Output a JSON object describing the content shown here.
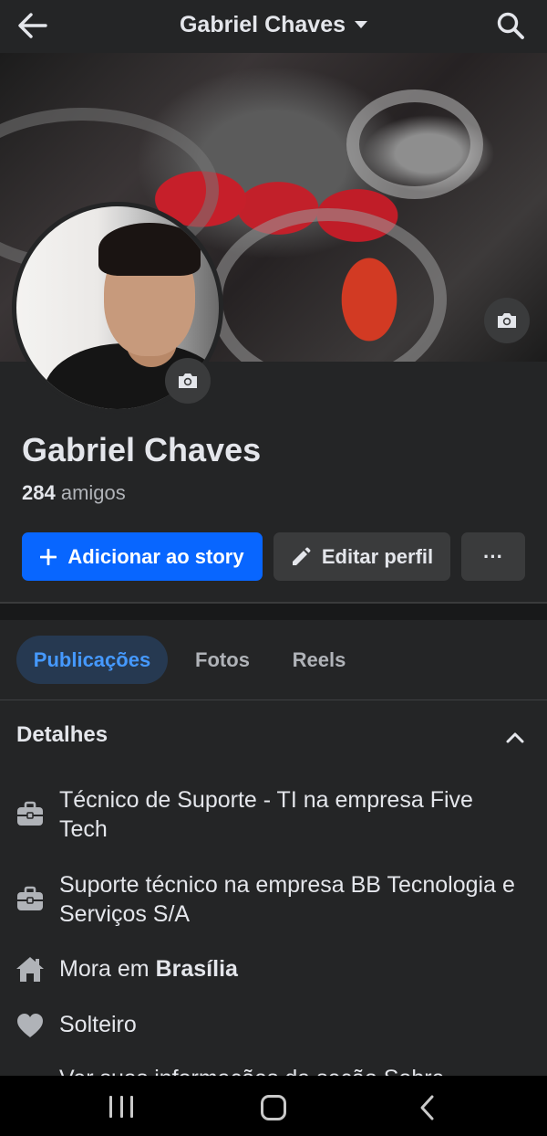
{
  "header": {
    "title": "Gabriel Chaves",
    "icons": {
      "back": "back-arrow-icon",
      "dropdown": "caret-down-icon",
      "search": "search-icon"
    }
  },
  "profile": {
    "name": "Gabriel Chaves",
    "friends_count": "284",
    "friends_label": "amigos"
  },
  "actions": {
    "add_story": "Adicionar ao story",
    "edit_profile": "Editar perfil",
    "more": "···"
  },
  "tabs": [
    {
      "label": "Publicações",
      "active": true
    },
    {
      "label": "Fotos",
      "active": false
    },
    {
      "label": "Reels",
      "active": false
    }
  ],
  "details": {
    "title": "Detalhes",
    "items": [
      {
        "icon": "briefcase-icon",
        "text": "Técnico de Suporte - TI na empresa Five Tech"
      },
      {
        "icon": "briefcase-icon",
        "text": "Suporte técnico na empresa BB Tecnologia e Serviços S/A"
      },
      {
        "icon": "home-icon",
        "prefix": "Mora em ",
        "bold": "Brasília"
      },
      {
        "icon": "heart-icon",
        "text": "Solteiro"
      },
      {
        "icon": "more-icon",
        "text": "Ver suas informações da seção Sobre"
      }
    ]
  },
  "colors": {
    "background": "#242526",
    "primary": "#0866ff",
    "secondary_button": "#3a3b3c",
    "active_tab_bg": "#263951",
    "active_tab_text": "#4599ff"
  }
}
